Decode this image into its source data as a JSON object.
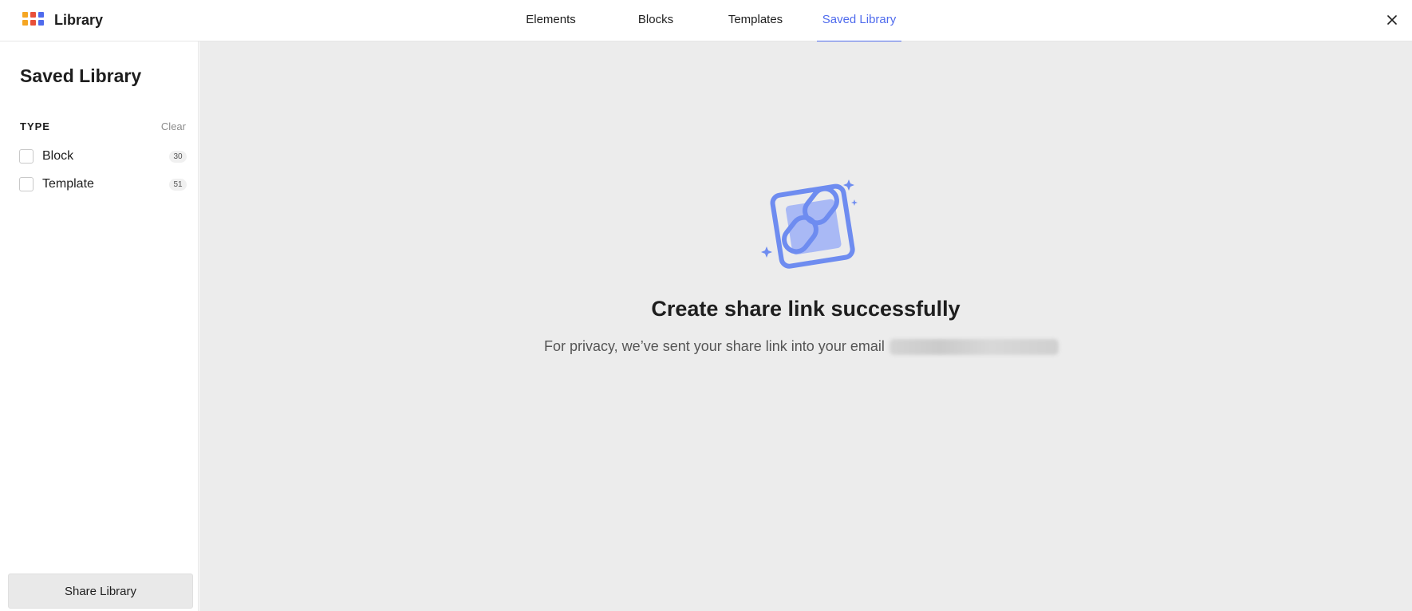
{
  "header": {
    "app_title": "Library",
    "tabs": [
      {
        "label": "Elements",
        "active": false
      },
      {
        "label": "Blocks",
        "active": false
      },
      {
        "label": "Templates",
        "active": false
      },
      {
        "label": "Saved Library",
        "active": true
      }
    ],
    "close_icon": "close-icon",
    "brand_colors": [
      "#f5a623",
      "#e8503a",
      "#4f6bed"
    ]
  },
  "sidebar": {
    "title": "Saved Library",
    "filter_heading": "TYPE",
    "clear_label": "Clear",
    "filters": [
      {
        "label": "Block",
        "count": "30",
        "checked": false
      },
      {
        "label": "Template",
        "count": "51",
        "checked": false
      }
    ],
    "share_button": "Share Library"
  },
  "main": {
    "icon": "share-link-icon",
    "title": "Create share link successfully",
    "description": "For privacy, we’ve sent your share link into your email"
  },
  "colors": {
    "accent": "#4f6bed",
    "illustration": "#6e8cf0",
    "illustration_fill": "#a9b9f5",
    "main_bg": "#ececec"
  }
}
